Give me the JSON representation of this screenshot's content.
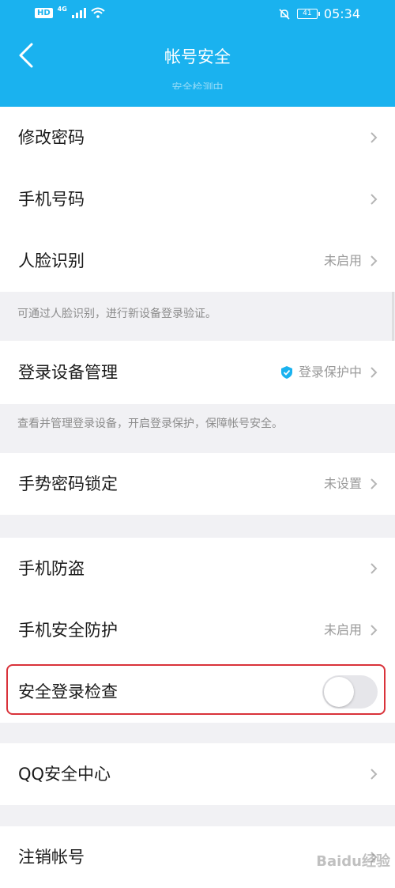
{
  "status": {
    "network": "4G",
    "time": "05:34",
    "battery": "41"
  },
  "header": {
    "title": "帐号安全",
    "ghost_text": "安全检测中"
  },
  "rows": [
    {
      "label": "修改密码",
      "value": ""
    },
    {
      "label": "手机号码",
      "value": ""
    },
    {
      "label": "人脸识别",
      "value": "未启用"
    },
    {
      "label": "登录设备管理",
      "value": "登录保护中"
    },
    {
      "label": "手势密码锁定",
      "value": "未设置"
    },
    {
      "label": "手机防盗",
      "value": ""
    },
    {
      "label": "手机安全防护",
      "value": "未启用"
    },
    {
      "label": "安全登录检查",
      "toggle_on": false
    },
    {
      "label": "QQ安全中心",
      "value": ""
    },
    {
      "label": "注销帐号",
      "value": ""
    }
  ],
  "notes": {
    "face": "可通过人脸识别，进行新设备登录验证。",
    "devices": "查看并管理登录设备，开启登录保护，保障帐号安全。"
  },
  "watermark": "Baidu经验",
  "colors": {
    "header": "#1ab2ef",
    "shield": "#1ab2ef",
    "highlight": "#d9323a"
  }
}
